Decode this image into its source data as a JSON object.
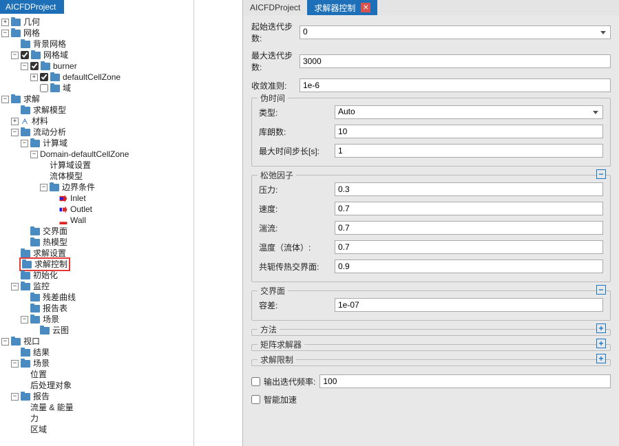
{
  "tree": {
    "tab": "AICFDProject",
    "geometry": "几何",
    "mesh": "网格",
    "bg_mesh": "背景网格",
    "mesh_domain": "网格域",
    "burner": "burner",
    "defaultCellZone": "defaultCellZone",
    "domain": "域",
    "solve": "求解",
    "solve_model": "求解模型",
    "material": "材料",
    "flow_analysis": "流动分析",
    "calc_domain": "计算域",
    "domain_dcz": "Domain-defaultCellZone",
    "calc_domain_setting": "计算域设置",
    "fluid_model": "流体模型",
    "boundary_cond": "边界条件",
    "inlet": "Inlet",
    "outlet": "Outlet",
    "wall": "Wall",
    "interface": "交界面",
    "thermal_model": "热模型",
    "solve_settings": "求解设置",
    "solve_control": "求解控制",
    "initialization": "初始化",
    "monitor": "监控",
    "residual_curve": "残差曲线",
    "report_table": "报告表",
    "scene": "场景",
    "contour": "云图",
    "viewport": "视口",
    "result": "结果",
    "scene2": "场景",
    "position": "位置",
    "post_object": "后处理对象",
    "report": "报告",
    "flow_energy": "流量 & 能量",
    "force": "力",
    "region": "区域"
  },
  "prop": {
    "tab1": "AICFDProject",
    "tab2": "求解器控制",
    "start_iter_label": "起始迭代步数:",
    "start_iter_value": "0",
    "max_iter_label": "最大迭代步数:",
    "max_iter_value": "3000",
    "converge_label": "收敛准则:",
    "converge_value": "1e-6",
    "pseudo_time": {
      "legend": "伪时间",
      "type_label": "类型:",
      "type_value": "Auto",
      "courant_label": "库朗数:",
      "courant_value": "10",
      "max_dt_label": "最大时间步长[s]:",
      "max_dt_value": "1"
    },
    "relax": {
      "legend": "松弛因子",
      "pressure_label": "压力:",
      "pressure_value": "0.3",
      "velocity_label": "速度:",
      "velocity_value": "0.7",
      "turb_label": "湍流:",
      "turb_value": "0.7",
      "temp_label": "温度（流体）:",
      "temp_value": "0.7",
      "cht_label": "共轭传热交界面:",
      "cht_value": "0.9"
    },
    "interface": {
      "legend": "交界面",
      "tol_label": "容差:",
      "tol_value": "1e-07"
    },
    "method_legend": "方法",
    "matrix_legend": "矩阵求解器",
    "limit_legend": "求解限制",
    "out_freq_label": "输出迭代频率:",
    "out_freq_value": "100",
    "smart_accel_label": "智能加速"
  }
}
